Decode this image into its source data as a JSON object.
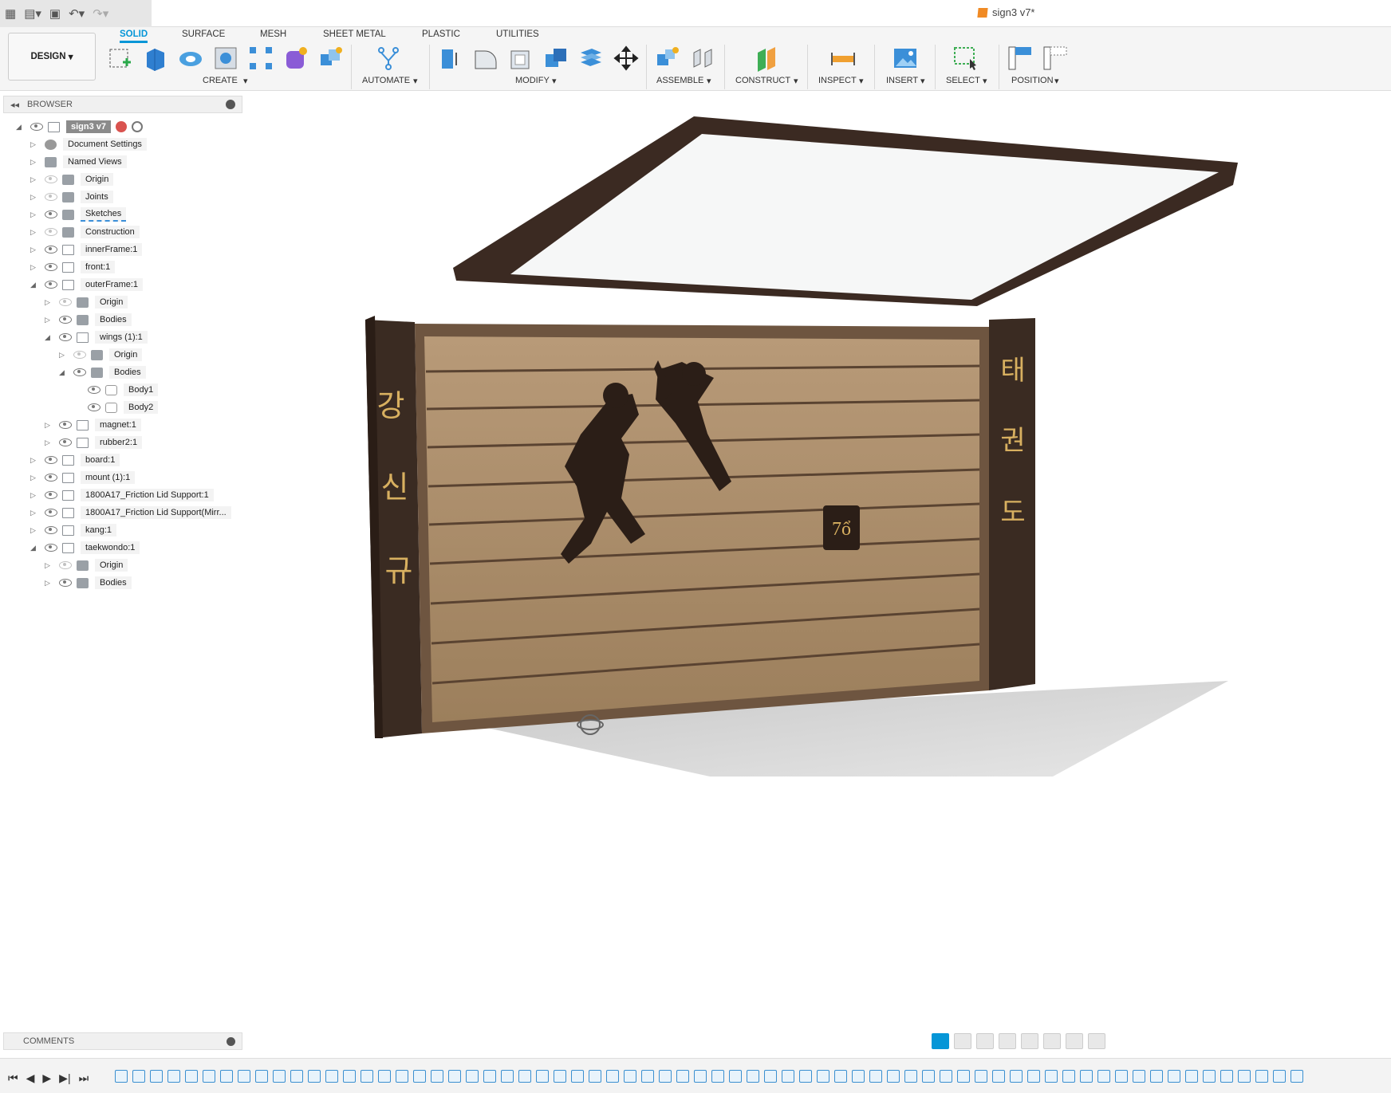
{
  "document": {
    "title": "sign3 v7*"
  },
  "workspace": {
    "label": "DESIGN"
  },
  "tabs": [
    {
      "label": "SOLID",
      "active": true
    },
    {
      "label": "SURFACE"
    },
    {
      "label": "MESH"
    },
    {
      "label": "SHEET METAL"
    },
    {
      "label": "PLASTIC"
    },
    {
      "label": "UTILITIES"
    }
  ],
  "groups": [
    {
      "label": "CREATE"
    },
    {
      "label": "AUTOMATE"
    },
    {
      "label": "MODIFY"
    },
    {
      "label": "ASSEMBLE"
    },
    {
      "label": "CONSTRUCT"
    },
    {
      "label": "INSPECT"
    },
    {
      "label": "INSERT"
    },
    {
      "label": "SELECT"
    },
    {
      "label": "POSITION"
    }
  ],
  "browser": {
    "title": "BROWSER",
    "items": [
      {
        "label": "sign3 v7"
      },
      {
        "label": "Document Settings"
      },
      {
        "label": "Named Views"
      },
      {
        "label": "Origin"
      },
      {
        "label": "Joints"
      },
      {
        "label": "Sketches"
      },
      {
        "label": "Construction"
      },
      {
        "label": "innerFrame:1"
      },
      {
        "label": "front:1"
      },
      {
        "label": "outerFrame:1"
      },
      {
        "label": "Origin"
      },
      {
        "label": "Bodies"
      },
      {
        "label": "wings (1):1"
      },
      {
        "label": "Origin"
      },
      {
        "label": "Bodies"
      },
      {
        "label": "Body1"
      },
      {
        "label": "Body2"
      },
      {
        "label": "magnet:1"
      },
      {
        "label": "rubber2:1"
      },
      {
        "label": "board:1"
      },
      {
        "label": "mount (1):1"
      },
      {
        "label": "1800A17_Friction Lid Support:1"
      },
      {
        "label": "1800A17_Friction Lid Support(Mirr..."
      },
      {
        "label": "kang:1"
      },
      {
        "label": "taekwondo:1"
      },
      {
        "label": "Origin"
      },
      {
        "label": "Bodies"
      }
    ]
  },
  "model": {
    "left_text": [
      "강",
      "신",
      "규"
    ],
    "right_text": [
      "태",
      "권",
      "도"
    ],
    "seal_text": "7ổ"
  },
  "comments": {
    "title": "COMMENTS"
  }
}
